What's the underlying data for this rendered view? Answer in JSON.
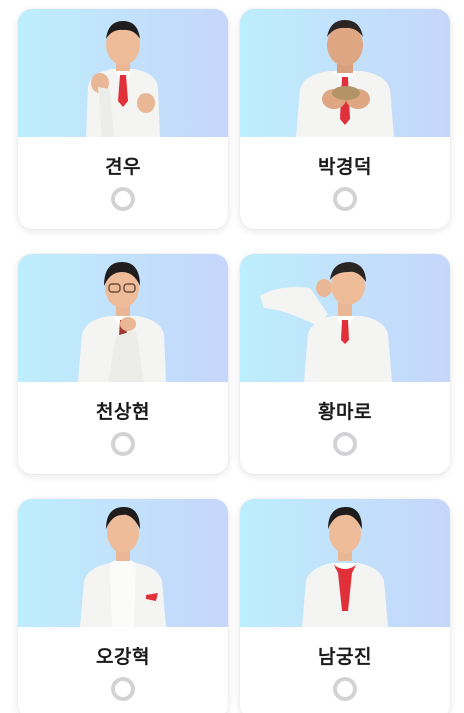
{
  "candidates": [
    {
      "name": "견우",
      "selected": false,
      "pose": "heart-hands"
    },
    {
      "name": "박경덕",
      "selected": false,
      "pose": "holding-object"
    },
    {
      "name": "천상현",
      "selected": false,
      "pose": "chin-thinker",
      "glasses": true
    },
    {
      "name": "황마로",
      "selected": false,
      "pose": "hand-behind-head"
    },
    {
      "name": "오강혁",
      "selected": false,
      "pose": "standing-turtleneck"
    },
    {
      "name": "남궁진",
      "selected": false,
      "pose": "standing-red-scarf"
    }
  ],
  "colors": {
    "photo_bg_start": "#bdeefd",
    "photo_bg_end": "#c5d6fb",
    "suit": "#f4f4f2",
    "accent_red": "#e0313a",
    "radio_ring": "#d3d3d6"
  }
}
